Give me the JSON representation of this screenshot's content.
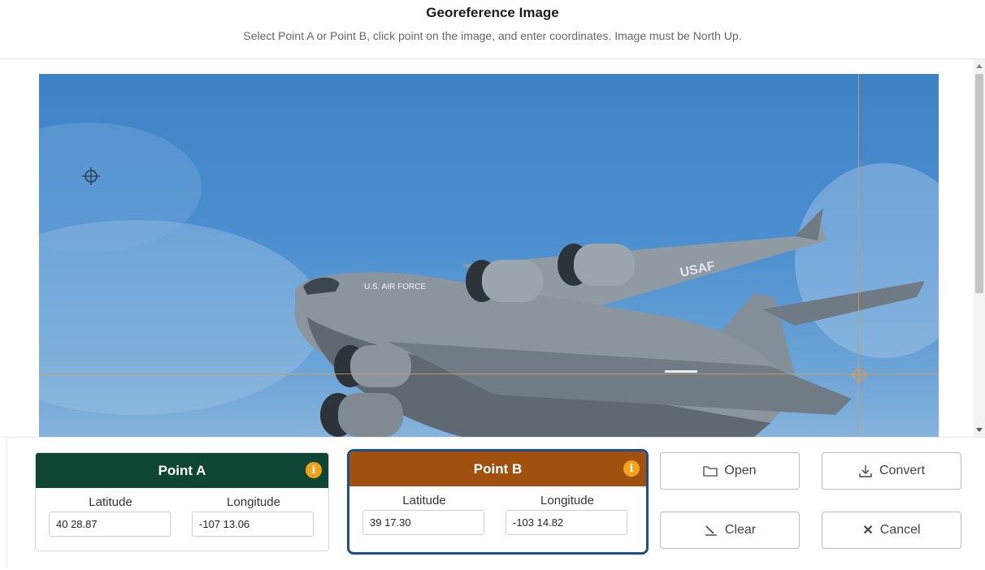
{
  "header": {
    "title": "Georeference Image",
    "subtitle": "Select Point A or Point B, click point on the image, and enter coordinates. Image must be North Up."
  },
  "points": {
    "a": {
      "title": "Point A",
      "lat_label": "Latitude",
      "lon_label": "Longitude",
      "lat_value": "40 28.87",
      "lon_value": "-107 13.06",
      "color": "#0f4534"
    },
    "b": {
      "title": "Point B",
      "lat_label": "Latitude",
      "lon_label": "Longitude",
      "lat_value": "39 17.30",
      "lon_value": "-103 14.82",
      "color": "#a0510f",
      "selected": true
    }
  },
  "buttons": {
    "open": "Open",
    "convert": "Convert",
    "clear": "Clear",
    "cancel": "Cancel"
  },
  "icons": [
    "crosshair-icon",
    "info-icon",
    "folder-icon",
    "download-icon",
    "eraser-icon",
    "close-icon",
    "scroll-up-icon",
    "scroll-down-icon"
  ],
  "colors": {
    "accent_selected_border": "#1f4f88",
    "guide_line": "#d69a55",
    "info_badge": "#f4a21a"
  }
}
